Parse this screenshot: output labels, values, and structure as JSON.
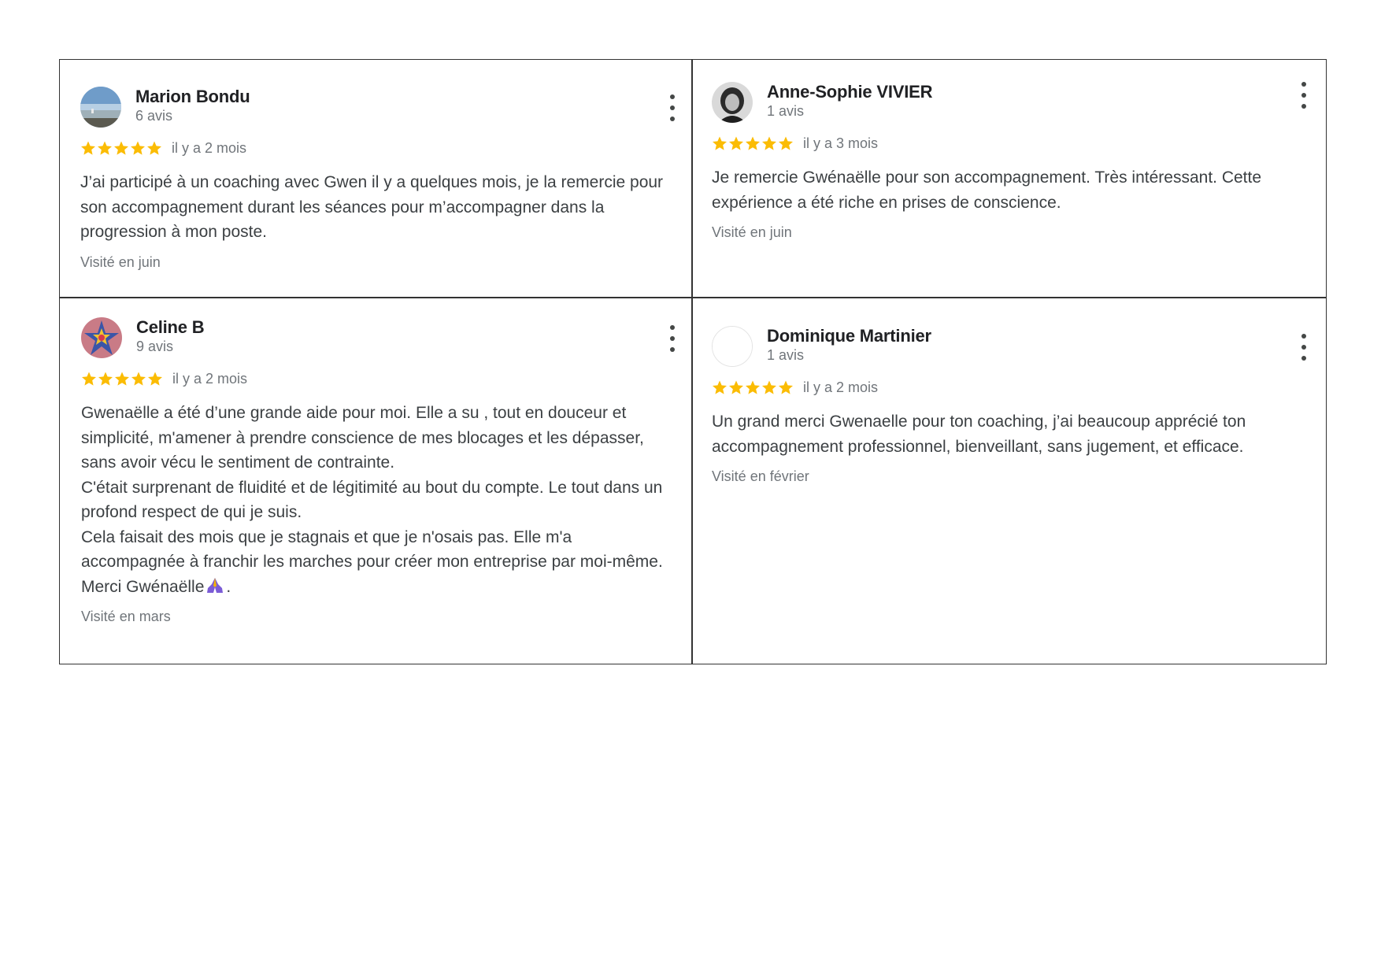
{
  "reviews": [
    {
      "name": "Marion Bondu",
      "count": "6 avis",
      "rating": 5,
      "when": "il y a 2 mois",
      "paragraphs": [
        "J’ai participé à un coaching avec Gwen il y a quelques mois, je la remercie pour son accompagnement durant les séances pour m’accompagner dans la progression à mon poste."
      ],
      "visited": "Visité en juin",
      "avatar_icon": "beach-photo-avatar"
    },
    {
      "name": "Anne-Sophie VIVIER",
      "count": "1 avis",
      "rating": 5,
      "when": "il y a 3 mois",
      "paragraphs": [
        "Je remercie Gwénaëlle pour son accompagnement. Très intéressant. Cette expérience a été riche en prises de conscience."
      ],
      "visited": "Visité en juin",
      "avatar_icon": "portrait-photo-avatar"
    },
    {
      "name": "Celine B",
      "count": "9 avis",
      "rating": 5,
      "when": "il y a 2 mois",
      "paragraphs": [
        "Gwenaëlle a été d’une grande aide pour moi. Elle a su , tout en douceur et simplicité, m'amener à prendre conscience de mes blocages et les dépasser, sans avoir vécu le sentiment de contrainte.",
        "C'était surprenant de fluidité et de légitimité au bout du compte. Le tout dans un profond respect de qui je suis.",
        "Cela faisait des mois que je stagnais et que je n'osais pas. Elle m'a accompagnée à franchir les marches pour créer mon entreprise par moi-même."
      ],
      "closing": "Merci Gwénaëlle",
      "closing_end": ".",
      "visited": "Visité en mars",
      "avatar_icon": "mandala-avatar"
    },
    {
      "name": "Dominique Martinier",
      "count": "1 avis",
      "rating": 5,
      "when": "il y a 2 mois",
      "paragraphs": [
        "Un grand merci Gwenaelle pour ton coaching, j’ai beaucoup apprécié ton accompagnement professionnel, bienveillant, sans jugement, et efficace."
      ],
      "visited": "Visité en février",
      "avatar_icon": "blank-avatar"
    }
  ],
  "colors": {
    "star": "#fbbc04",
    "border": "#333333",
    "muted": "#70757a",
    "text": "#3c4043"
  },
  "icons": {
    "star": "star-icon",
    "more": "more-vert-icon",
    "pray": "folded-hands-emoji"
  }
}
